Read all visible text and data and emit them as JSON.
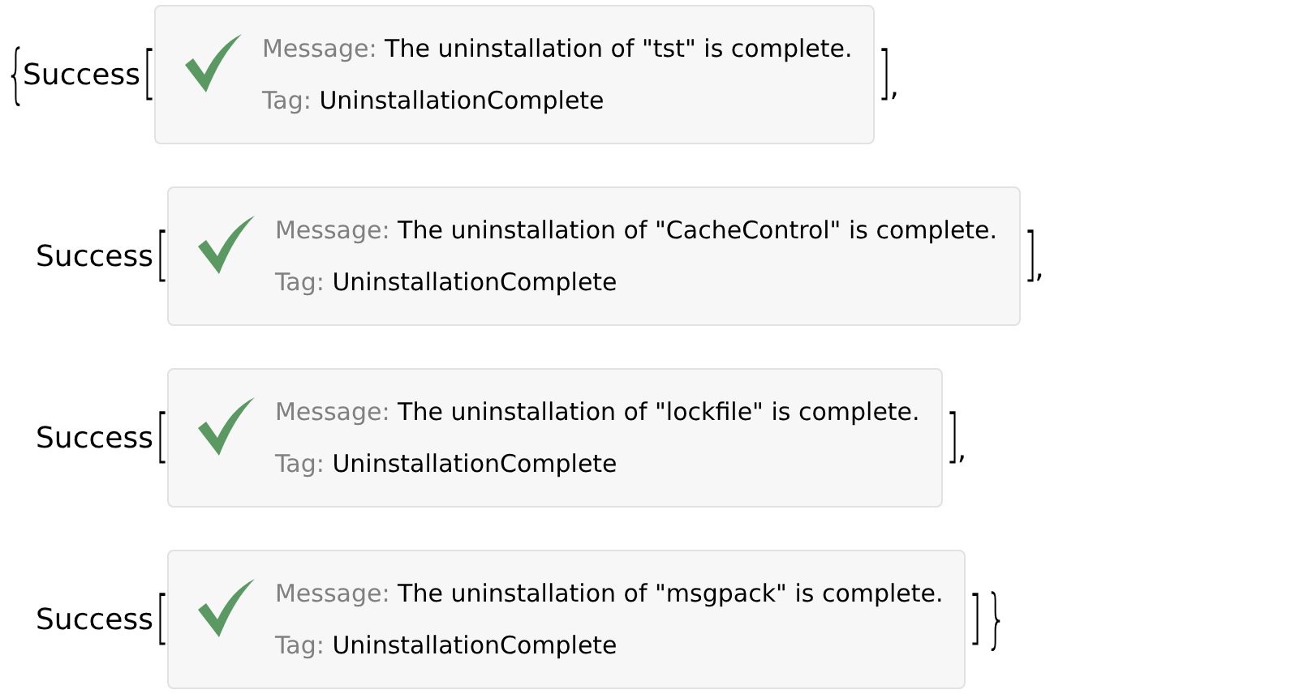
{
  "brace_open": "{",
  "brace_close": "}",
  "items": [
    {
      "label": "Success",
      "open": "[",
      "message_label": "Message:",
      "message": "The uninstallation of \"tst\" is complete.",
      "tag_label": "Tag:",
      "tag": "UninstallationComplete",
      "close": "]",
      "separator": ","
    },
    {
      "label": "Success",
      "open": "[",
      "message_label": "Message:",
      "message": "The uninstallation of \"CacheControl\" is complete.",
      "tag_label": "Tag:",
      "tag": "UninstallationComplete",
      "close": "]",
      "separator": ","
    },
    {
      "label": "Success",
      "open": "[",
      "message_label": "Message:",
      "message": "The uninstallation of \"lockfile\" is complete.",
      "tag_label": "Tag:",
      "tag": "UninstallationComplete",
      "close": "]",
      "separator": ","
    },
    {
      "label": "Success",
      "open": "[",
      "message_label": "Message:",
      "message": "The uninstallation of \"msgpack\" is complete.",
      "tag_label": "Tag:",
      "tag": "UninstallationComplete",
      "close": "]"
    }
  ]
}
